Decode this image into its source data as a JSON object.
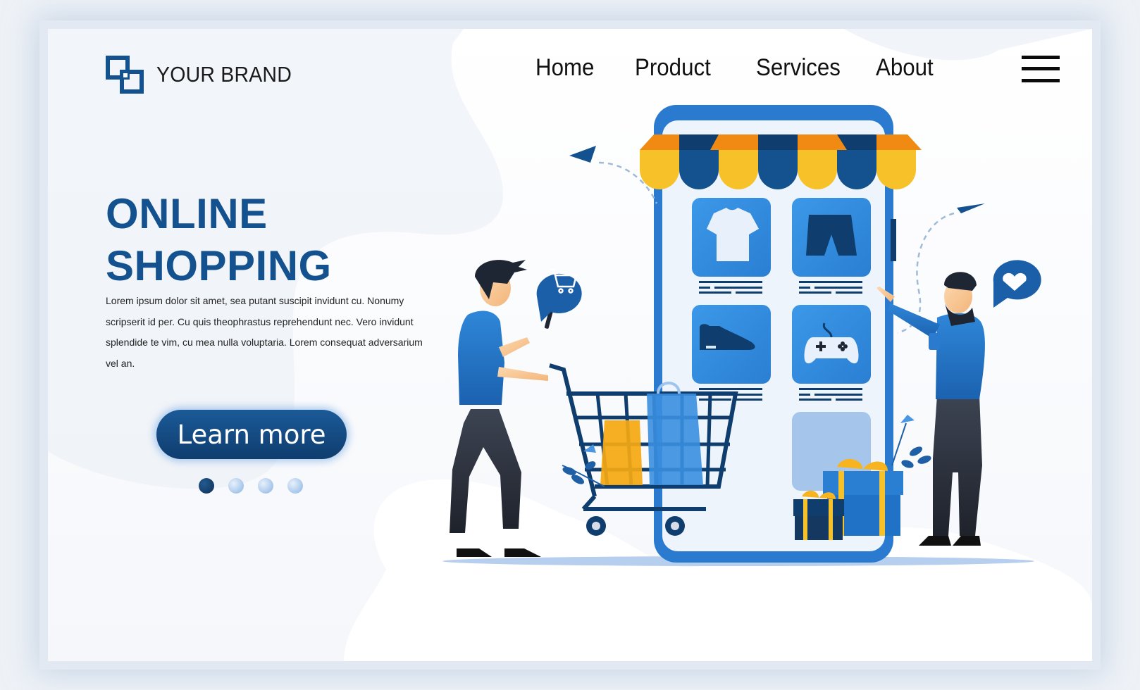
{
  "brand": {
    "name": "YOUR BRAND",
    "logo_icon": "overlapping-squares-logo"
  },
  "nav": {
    "items": [
      {
        "label": "Home"
      },
      {
        "label": "Product"
      },
      {
        "label": "Services"
      },
      {
        "label": "About"
      }
    ],
    "menu_icon": "hamburger-menu-icon"
  },
  "hero": {
    "title_line1": "ONLINE",
    "title_line2": "SHOPPING",
    "body": "Lorem ipsum dolor sit amet, sea putant suscipit invidunt cu. Nonumy scripserit id per. Cu quis theophrastus reprehendunt nec. Vero invidunt splendide te vim, cu mea nulla voluptaria. Lorem consequat adversarium vel an.",
    "cta_label": "Learn more",
    "carousel": {
      "total": 4,
      "active_index": 0
    }
  },
  "illustration": {
    "phone_store_items": [
      "t-shirt-icon",
      "shorts-icon",
      "sneaker-icon",
      "gamepad-icon",
      "empty-slot"
    ],
    "speech_bubbles": [
      "shopping-cart-icon",
      "heart-icon"
    ],
    "decorations": [
      "paper-plane-icon",
      "paper-plane-icon",
      "shopping-cart",
      "shopping-bag-yellow",
      "shopping-bag-blue",
      "gift-box-large",
      "gift-box-small",
      "flower-plant",
      "flower-plant"
    ],
    "people": [
      "man-with-cart-and-phone",
      "bearded-man-pointing"
    ]
  },
  "colors": {
    "brand_blue": "#14528f",
    "dark_navy": "#0f3d6e",
    "accent_blue": "#2f86d8",
    "awning_yellow": "#f7c12a",
    "awning_orange": "#f08a12"
  }
}
